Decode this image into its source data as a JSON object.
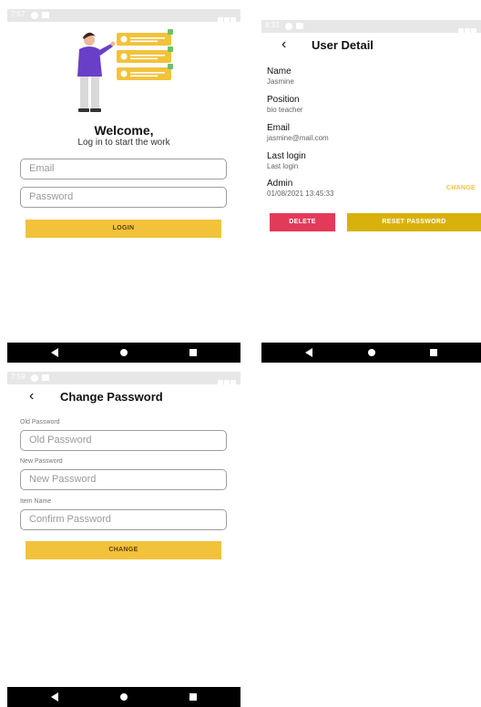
{
  "colors": {
    "accent": "#f3c23b",
    "danger": "#e23b5a",
    "gold": "#d9b10c"
  },
  "login": {
    "status_time": "7:57",
    "welcome": "Welcome,",
    "subtitle": "Log in to start the work",
    "email_placeholder": "Email",
    "password_placeholder": "Password",
    "login_label": "LOGIN"
  },
  "user_detail": {
    "status_time": "8:33",
    "title": "User Detail",
    "fields": [
      {
        "label": "Name",
        "value": "Jasmine"
      },
      {
        "label": "Position",
        "value": "bio teacher"
      },
      {
        "label": "Email",
        "value": "jasmine@mail.com"
      },
      {
        "label": "Last login",
        "value": "Last login"
      },
      {
        "label": "Admin",
        "value": "01/08/2021 13:45:33"
      }
    ],
    "change_label": "CHANGE",
    "delete_label": "DELETE",
    "reset_label": "RESET PASSWORD"
  },
  "change_password": {
    "status_time": "7:59",
    "title": "Change Password",
    "old_label": "Old Password",
    "old_placeholder": "Old Password",
    "new_label": "New Password",
    "new_placeholder": "New Password",
    "confirm_label": "Item Name",
    "confirm_placeholder": "Confirm Password",
    "change_label": "CHANGE"
  }
}
